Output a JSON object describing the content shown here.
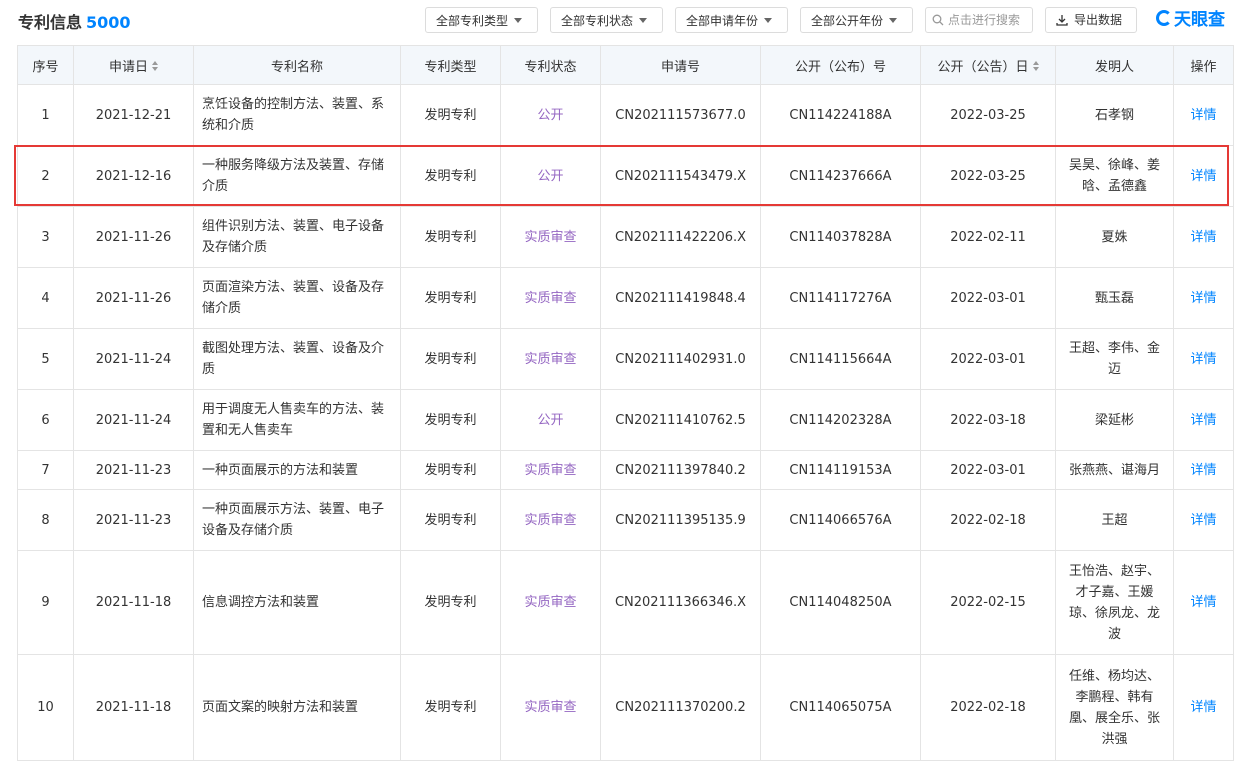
{
  "header": {
    "title": "专利信息",
    "count": "5000",
    "filters": [
      "全部专利类型",
      "全部专利状态",
      "全部申请年份",
      "全部公开年份"
    ],
    "search_placeholder": "点击进行搜索",
    "export_label": "导出数据",
    "brand": "天眼查"
  },
  "colors": {
    "accent": "#0084ff",
    "status": "#9466c2",
    "highlight": "#e53935"
  },
  "table": {
    "columns": [
      "序号",
      "申请日",
      "专利名称",
      "专利类型",
      "专利状态",
      "申请号",
      "公开（公布）号",
      "公开（公告）日",
      "发明人",
      "操作"
    ],
    "rows": [
      {
        "no": "1",
        "date": "2021-12-21",
        "name": "烹饪设备的控制方法、装置、系统和介质",
        "type": "发明专利",
        "status": "公开",
        "app_no": "CN202111573677.0",
        "pub_no": "CN114224188A",
        "pub_date": "2022-03-25",
        "inventors": "石孝钢",
        "action": "详情"
      },
      {
        "no": "2",
        "date": "2021-12-16",
        "name": "一种服务降级方法及装置、存储介质",
        "type": "发明专利",
        "status": "公开",
        "app_no": "CN202111543479.X",
        "pub_no": "CN114237666A",
        "pub_date": "2022-03-25",
        "inventors": "吴昊、徐峰、姜晗、孟德鑫",
        "action": "详情"
      },
      {
        "no": "3",
        "date": "2021-11-26",
        "name": "组件识别方法、装置、电子设备及存储介质",
        "type": "发明专利",
        "status": "实质审查",
        "app_no": "CN202111422206.X",
        "pub_no": "CN114037828A",
        "pub_date": "2022-02-11",
        "inventors": "夏姝",
        "action": "详情"
      },
      {
        "no": "4",
        "date": "2021-11-26",
        "name": "页面渲染方法、装置、设备及存储介质",
        "type": "发明专利",
        "status": "实质审查",
        "app_no": "CN202111419848.4",
        "pub_no": "CN114117276A",
        "pub_date": "2022-03-01",
        "inventors": "甄玉磊",
        "action": "详情"
      },
      {
        "no": "5",
        "date": "2021-11-24",
        "name": "截图处理方法、装置、设备及介质",
        "type": "发明专利",
        "status": "实质审查",
        "app_no": "CN202111402931.0",
        "pub_no": "CN114115664A",
        "pub_date": "2022-03-01",
        "inventors": "王超、李伟、金迈",
        "action": "详情"
      },
      {
        "no": "6",
        "date": "2021-11-24",
        "name": "用于调度无人售卖车的方法、装置和无人售卖车",
        "type": "发明专利",
        "status": "公开",
        "app_no": "CN202111410762.5",
        "pub_no": "CN114202328A",
        "pub_date": "2022-03-18",
        "inventors": "梁延彬",
        "action": "详情"
      },
      {
        "no": "7",
        "date": "2021-11-23",
        "name": "一种页面展示的方法和装置",
        "type": "发明专利",
        "status": "实质审查",
        "app_no": "CN202111397840.2",
        "pub_no": "CN114119153A",
        "pub_date": "2022-03-01",
        "inventors": "张燕燕、谌海月",
        "action": "详情"
      },
      {
        "no": "8",
        "date": "2021-11-23",
        "name": "一种页面展示方法、装置、电子设备及存储介质",
        "type": "发明专利",
        "status": "实质审查",
        "app_no": "CN202111395135.9",
        "pub_no": "CN114066576A",
        "pub_date": "2022-02-18",
        "inventors": "王超",
        "action": "详情"
      },
      {
        "no": "9",
        "date": "2021-11-18",
        "name": "信息调控方法和装置",
        "type": "发明专利",
        "status": "实质审查",
        "app_no": "CN202111366346.X",
        "pub_no": "CN114048250A",
        "pub_date": "2022-02-15",
        "inventors": "王怡浩、赵宇、才子嘉、王媛琼、徐夙龙、龙波",
        "action": "详情"
      },
      {
        "no": "10",
        "date": "2021-11-18",
        "name": "页面文案的映射方法和装置",
        "type": "发明专利",
        "status": "实质审查",
        "app_no": "CN202111370200.2",
        "pub_no": "CN114065075A",
        "pub_date": "2022-02-18",
        "inventors": "任维、杨均达、李鹏程、韩有凰、展全乐、张洪强",
        "action": "详情"
      }
    ]
  }
}
